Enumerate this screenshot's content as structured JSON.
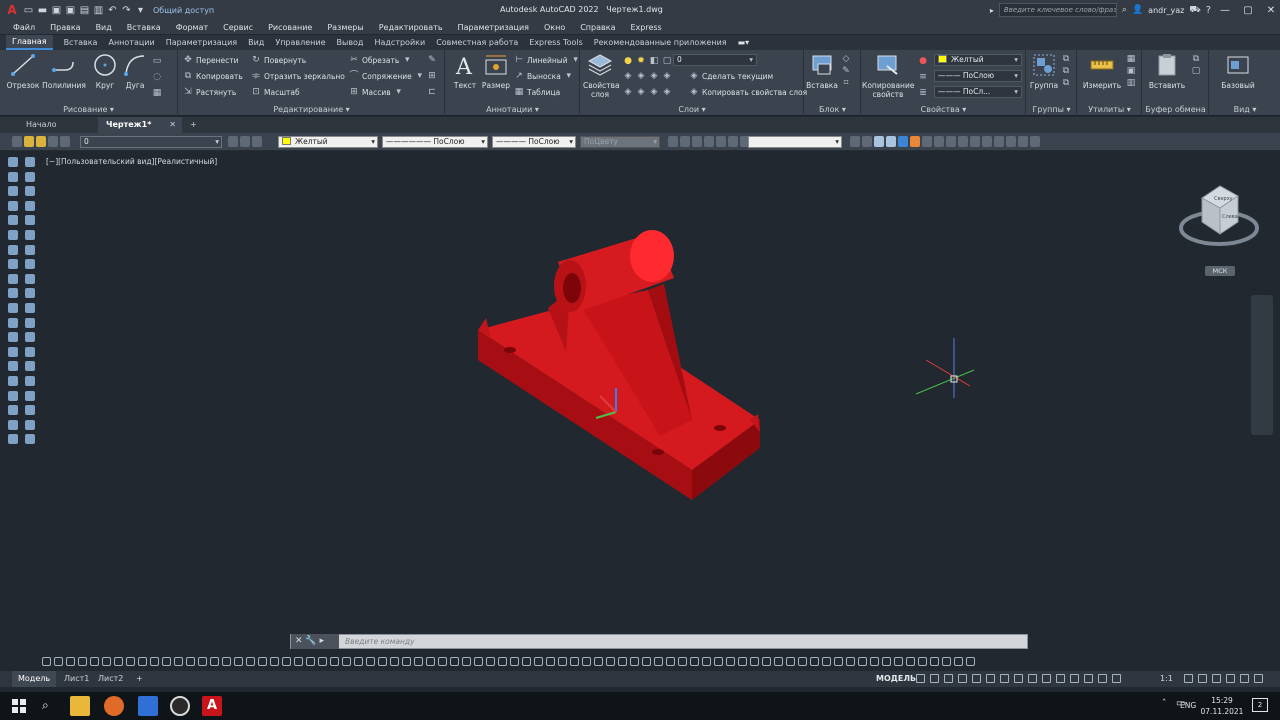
{
  "title_bar": {
    "share_label": "Общий доступ",
    "app_title": "Autodesk AutoCAD 2022",
    "file_name": "Чертеж1.dwg",
    "search_placeholder": "Введите ключевое слово/фразу",
    "user": "andr_yaz"
  },
  "menu": [
    "Файл",
    "Правка",
    "Вид",
    "Вставка",
    "Формат",
    "Сервис",
    "Рисование",
    "Размеры",
    "Редактировать",
    "Параметризация",
    "Окно",
    "Справка",
    "Express"
  ],
  "ribbon_tabs": [
    {
      "label": "Главная",
      "active": true
    },
    {
      "label": "Вставка"
    },
    {
      "label": "Аннотации"
    },
    {
      "label": "Параметризация"
    },
    {
      "label": "Вид"
    },
    {
      "label": "Управление"
    },
    {
      "label": "Вывод"
    },
    {
      "label": "Надстройки"
    },
    {
      "label": "Совместная работа"
    },
    {
      "label": "Express Tools"
    },
    {
      "label": "Рекомендованные приложения"
    }
  ],
  "ribbon": {
    "draw": {
      "title": "Рисование ▾",
      "line": "Отрезок",
      "polyline": "Полилиния",
      "circle": "Круг",
      "arc": "Дуга"
    },
    "modify": {
      "title": "Редактирование ▾",
      "move": "Перенести",
      "rotate": "Повернуть",
      "trim": "Обрезать",
      "copy": "Копировать",
      "mirror": "Отразить зеркально",
      "fillet": "Сопряжение",
      "stretch": "Растянуть",
      "scale": "Масштаб",
      "array": "Массив"
    },
    "annotation": {
      "title": "Аннотации ▾",
      "text": "Текст",
      "dimension": "Размер",
      "linear": "Линейный",
      "leader": "Выноска",
      "table": "Таблица"
    },
    "layers": {
      "title": "Слои ▾",
      "layer_props": "Свойства слоя",
      "current_layer": "0",
      "make_current": "Сделать текущим",
      "match_layer": "Копировать свойства слоя"
    },
    "block": {
      "title": "Блок ▾",
      "insert": "Вставка"
    },
    "properties": {
      "title": "Свойства ▾",
      "match": "Копирование свойств",
      "color": "Желтый",
      "linetype": "ПоСлою",
      "lineweight": "ПоСл..."
    },
    "groups": {
      "title": "Группы ▾",
      "group": "Группа"
    },
    "utilities": {
      "title": "Утилиты ▾",
      "measure": "Измерить"
    },
    "clipboard": {
      "title": "Буфер обмена",
      "paste": "Вставить"
    },
    "view": {
      "title": "Вид ▾",
      "base": "Базовый"
    }
  },
  "doc_tabs": {
    "start": "Начало",
    "drawing": "Чертеж1*"
  },
  "props_toolbar": {
    "layer": "0",
    "color": "Желтый",
    "linetype": "ПоСлою",
    "lineweight": "ПоСлою",
    "plotstyle": "ПоЦвету"
  },
  "viewport": {
    "label": "[−][Пользовательский вид][Реалистичный]",
    "ucs": "МСК",
    "viewcube_face_top": "Сверху",
    "viewcube_face_left": "Слева",
    "model_color": "#c8141b"
  },
  "command_line": {
    "placeholder": "Введите команду"
  },
  "layout_tabs": [
    {
      "label": "Модель",
      "active": true
    },
    {
      "label": "Лист1"
    },
    {
      "label": "Лист2"
    }
  ],
  "status": {
    "model": "МОДЕЛЬ",
    "scale": "1:1"
  },
  "taskbar": {
    "lang": "ENG",
    "time": "15:29",
    "date": "07.11.2021",
    "notifications": "2"
  }
}
